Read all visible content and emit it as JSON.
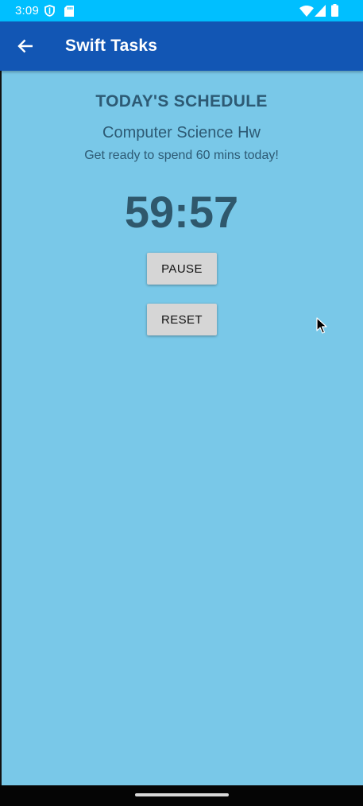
{
  "status_bar": {
    "time": "3:09",
    "background": "#00bfff",
    "icons": [
      "shield-icon",
      "sd-card-icon",
      "wifi-icon",
      "signal-icon",
      "battery-icon"
    ]
  },
  "app_bar": {
    "title": "Swift Tasks",
    "back_icon": "arrow-back-icon",
    "background": "#1256b4"
  },
  "schedule": {
    "heading": "TODAY'S SCHEDULE",
    "task_name": "Computer Science Hw",
    "subtitle": "Get ready to spend 60 mins today!",
    "timer": "59:57",
    "background": "#79c8e8",
    "text_color": "#2d5a74"
  },
  "buttons": {
    "pause_label": "PAUSE",
    "reset_label": "RESET"
  }
}
